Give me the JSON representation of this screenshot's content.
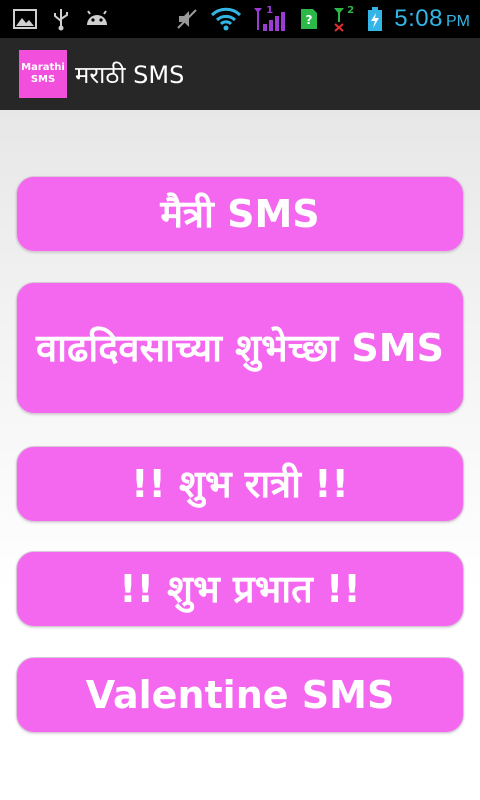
{
  "status_bar": {
    "time": "5:08",
    "ampm": "PM",
    "signal_label_1": "1",
    "signal_label_2": "2",
    "icons": [
      "image-icon",
      "usb-icon",
      "android-debug-icon",
      "mute-icon",
      "wifi-icon",
      "signal-1-icon",
      "sim-unknown-icon",
      "signal-2-icon",
      "battery-charging-icon"
    ],
    "accent_color": "#33b5e5"
  },
  "action_bar": {
    "logo_line1": "Marathi",
    "logo_line2": "SMS",
    "title": "मराठी SMS"
  },
  "menu": {
    "items": [
      {
        "label": "मैत्री SMS"
      },
      {
        "label": "वाढदिवसाच्या शुभेच्छा SMS"
      },
      {
        "label": "!! शुभ रात्री !!"
      },
      {
        "label": "!! शुभ प्रभात !!"
      },
      {
        "label": "Valentine SMS"
      }
    ],
    "button_color": "#f468f0"
  }
}
